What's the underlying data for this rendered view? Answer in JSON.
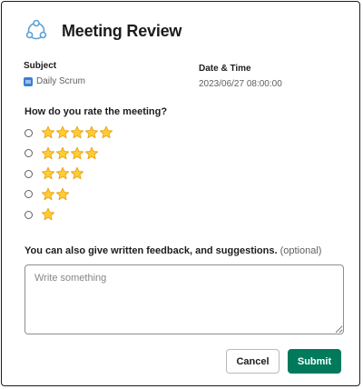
{
  "modal": {
    "title": "Meeting Review",
    "app_icon": "triangle-dots-icon"
  },
  "subject": {
    "label": "Subject",
    "value": "Daily Scrum",
    "icon": "channel-icon"
  },
  "datetime": {
    "label": "Date & Time",
    "value": "2023/06/27 08:00:00"
  },
  "rating": {
    "question": "How do you rate the meeting?",
    "options": [
      {
        "stars": 5,
        "selected": false
      },
      {
        "stars": 4,
        "selected": false
      },
      {
        "stars": 3,
        "selected": false
      },
      {
        "stars": 2,
        "selected": false
      },
      {
        "stars": 1,
        "selected": false
      }
    ]
  },
  "feedback": {
    "label": "You can also give written feedback, and suggestions.",
    "optional_text": "(optional)",
    "placeholder": "Write something",
    "value": ""
  },
  "actions": {
    "cancel_label": "Cancel",
    "submit_label": "Submit"
  },
  "colors": {
    "submit_bg": "#007a5a",
    "star_fill": "#ffcc33",
    "star_stroke": "#e8a317"
  }
}
